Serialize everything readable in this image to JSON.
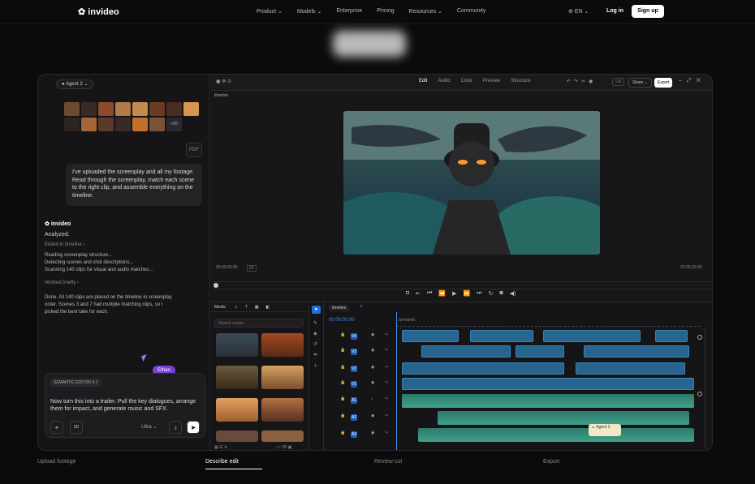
{
  "nav": {
    "logo": "invideo",
    "links": [
      "Product",
      "Models",
      "Enterprise",
      "Pricing",
      "Resources",
      "Community"
    ],
    "lang": "EN",
    "login": "Log in",
    "signup": "Sign up"
  },
  "chat": {
    "agent": "Agent 2",
    "pdf": "PDF",
    "more": "+85",
    "user_msg": "I've uploaded the screenplay and all my footage. Read through the screenplay, match each scene to the right clip, and assemble everything on the timeline.",
    "brand": "invideo",
    "analyzed": "Analyzed.",
    "edited": "Edited in timeline ›",
    "log": [
      "Reading screenplay structure...",
      "Detecting scenes and shot descriptions...",
      "Scanning 140 clips for visual and audio matches..."
    ],
    "worked": "Worked briefly ›",
    "done": "Done. All 140 clips are placed on the timeline in screenplay order. Scenes 3 and 7 had multiple matching clips, so I picked the best take for each.",
    "cursor_name": "Ethan",
    "tag": "SEMANTIC EDITOR 4.1",
    "prompt": "Now turn this into a trailer. Pull the key dialogues, arrange them for impact, and generate music and SFX.",
    "mode": "Ultra ⌄",
    "btn3d": "3D"
  },
  "editor": {
    "tabs": [
      "Edit",
      "Audio",
      "Color",
      "Preview",
      "Structure"
    ],
    "share": "Share",
    "export": "Export",
    "timeline_label": "timeline",
    "time_left": "00:00:00:06",
    "fps": "24",
    "time_right": "00:00:20:00",
    "media_tab": "Media",
    "search_placeholder": "Search media",
    "timeline_tab": "timeline",
    "timecode": "00:00:00:00",
    "semantic": "Semantic",
    "agent2": "Agent 2",
    "tracks": [
      "V4",
      "V3",
      "V2",
      "V1",
      "A1",
      "A2",
      "A3"
    ]
  },
  "steps": [
    "Upload footage",
    "Describe edit",
    "Review cut",
    "Export"
  ],
  "colors": {
    "accent": "#3a8ef0",
    "cursor": "#7a3fd6"
  }
}
